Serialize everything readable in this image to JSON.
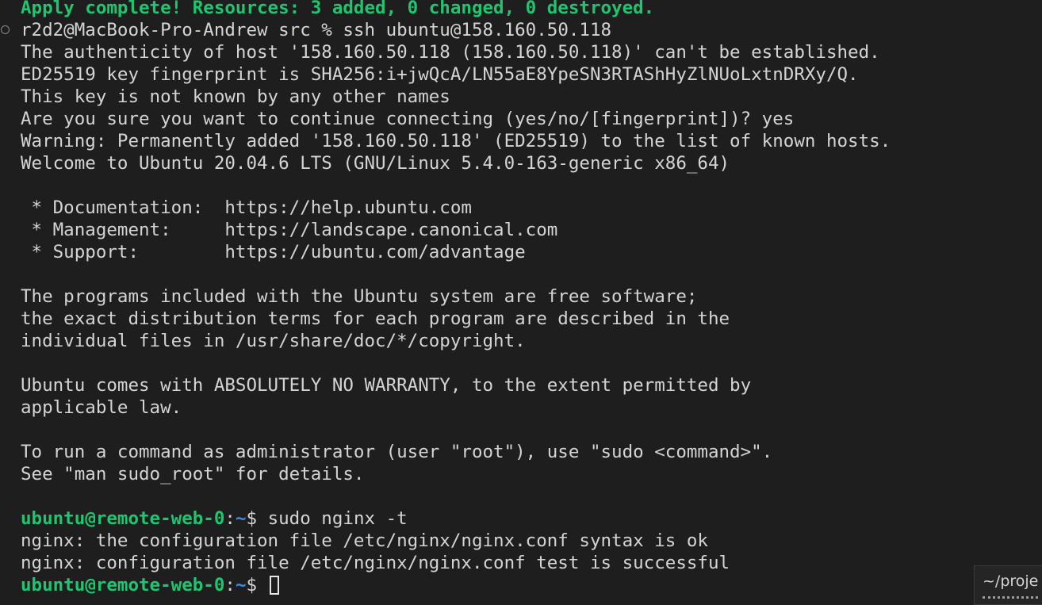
{
  "terminal": {
    "apply_message": "Apply complete! Resources: 3 added, 0 changed, 0 destroyed.",
    "local_prompt": "r2d2@MacBook-Pro-Andrew src % ",
    "local_command": "ssh ubuntu@158.160.50.118",
    "ssh_output": [
      "The authenticity of host '158.160.50.118 (158.160.50.118)' can't be established.",
      "ED25519 key fingerprint is SHA256:i+jwQcA/LN55aE8YpeSN3RTAShHyZlNUoLxtnDRXy/Q.",
      "This key is not known by any other names",
      "Are you sure you want to continue connecting (yes/no/[fingerprint])? yes",
      "Warning: Permanently added '158.160.50.118' (ED25519) to the list of known hosts.",
      "Welcome to Ubuntu 20.04.6 LTS (GNU/Linux 5.4.0-163-generic x86_64)"
    ],
    "motd_links": [
      " * Documentation:  https://help.ubuntu.com",
      " * Management:     https://landscape.canonical.com",
      " * Support:        https://ubuntu.com/advantage"
    ],
    "motd_license": [
      "The programs included with the Ubuntu system are free software;",
      "the exact distribution terms for each program are described in the",
      "individual files in /usr/share/doc/*/copyright."
    ],
    "motd_warranty": [
      "Ubuntu comes with ABSOLUTELY NO WARRANTY, to the extent permitted by",
      "applicable law."
    ],
    "motd_sudo": [
      "To run a command as administrator (user \"root\"), use \"sudo <command>\".",
      "See \"man sudo_root\" for details."
    ],
    "remote_prompt": {
      "user_host": "ubuntu@remote-web-0",
      "colon": ":",
      "path": "~",
      "dollar": "$ "
    },
    "remote_command": "sudo nginx -t",
    "nginx_output": [
      "nginx: the configuration file /etc/nginx/nginx.conf syntax is ok",
      "nginx: configuration file /etc/nginx/nginx.conf test is successful"
    ]
  },
  "tooltip": {
    "text": "~/proje"
  },
  "colors": {
    "background": "#1e1e1e",
    "foreground": "#d4d4d4",
    "prompt_green": "#1ec66f",
    "prompt_blue": "#3b8eea"
  }
}
